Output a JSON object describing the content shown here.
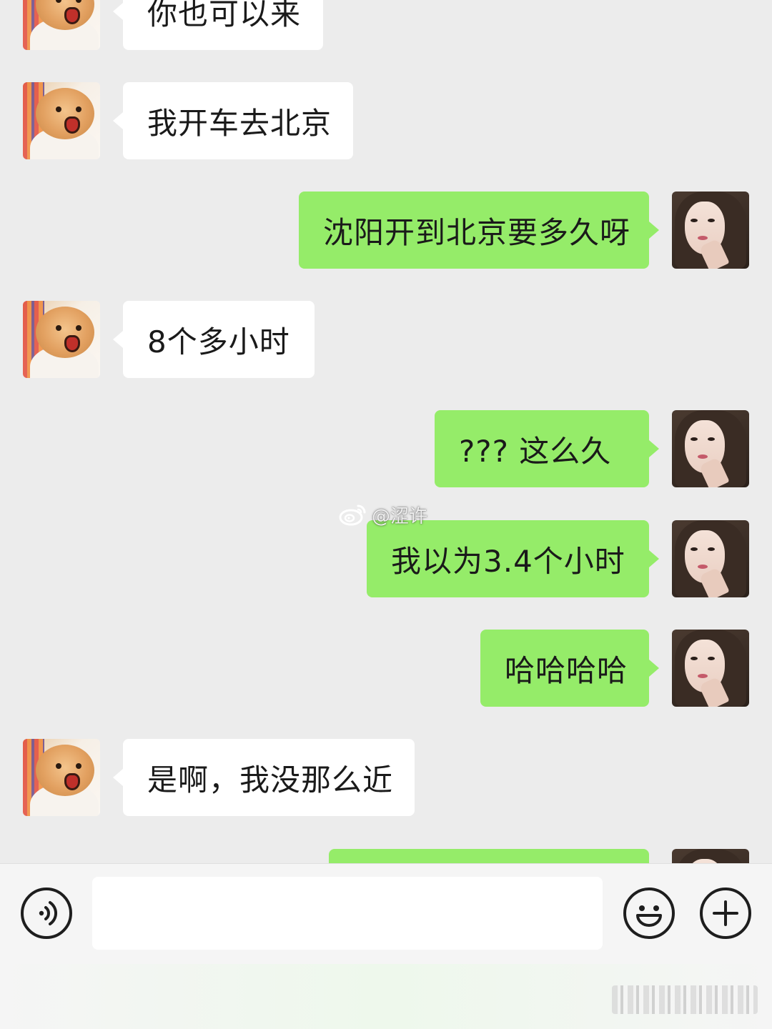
{
  "messages": [
    {
      "side": "in",
      "text": "你也可以来"
    },
    {
      "side": "in",
      "text": "我开车去北京"
    },
    {
      "side": "out",
      "text": "沈阳开到北京要多久呀"
    },
    {
      "side": "in",
      "text": "8个多小时"
    },
    {
      "side": "out",
      "text": "??? 这么久"
    },
    {
      "side": "out",
      "text": "我以为3.4个小时"
    },
    {
      "side": "out",
      "text": "哈哈哈哈"
    },
    {
      "side": "in",
      "text": "是啊，我没那么近"
    },
    {
      "side": "out",
      "text": ""
    }
  ],
  "watermark": {
    "text": "@涩许",
    "icon": "weibo-icon"
  },
  "input_bar": {
    "voice_icon": "voice-icon",
    "input_value": "",
    "emoji_icon": "emoji-icon",
    "plus_icon": "plus-icon"
  },
  "colors": {
    "background": "#ececec",
    "incoming_bubble": "#ffffff",
    "outgoing_bubble": "#95ec69"
  }
}
